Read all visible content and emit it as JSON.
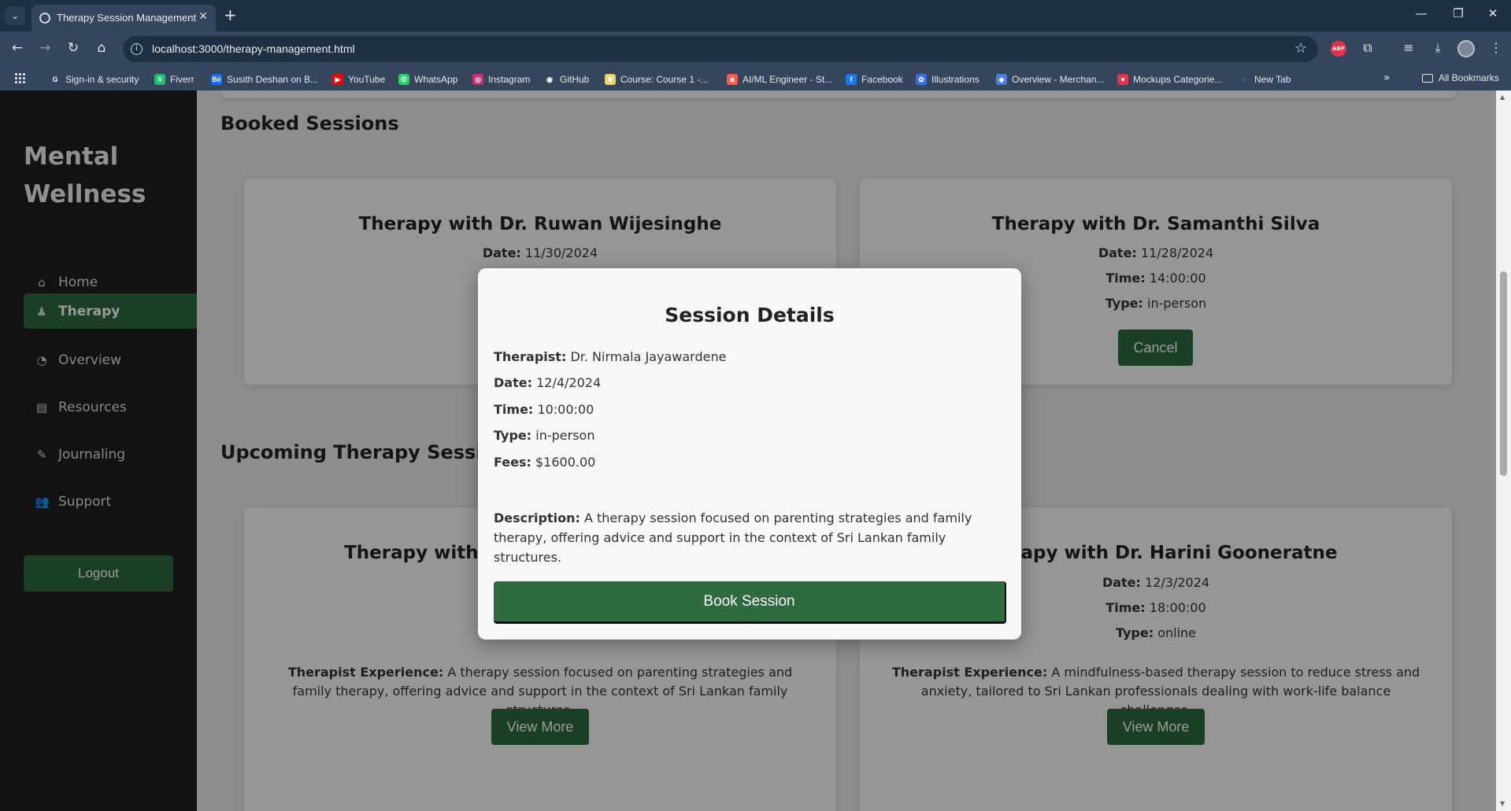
{
  "browser": {
    "tab_title": "Therapy Session Management",
    "url": "localhost:3000/therapy-management.html",
    "bookmarks": [
      {
        "label": "Sign-in & security",
        "icon": "google-icon",
        "color": "#ffffff"
      },
      {
        "label": "Fiverr",
        "icon": "fiverr-icon",
        "color": "#1dbf73"
      },
      {
        "label": "Susith Deshan on B...",
        "icon": "behance-icon",
        "color": "#1769ff"
      },
      {
        "label": "YouTube",
        "icon": "youtube-icon",
        "color": "#ff0000"
      },
      {
        "label": "WhatsApp",
        "icon": "whatsapp-icon",
        "color": "#25d366"
      },
      {
        "label": "Instagram",
        "icon": "instagram-icon",
        "color": "#d62976"
      },
      {
        "label": "GitHub",
        "icon": "github-icon",
        "color": "#ffffff"
      },
      {
        "label": "Course: Course 1 -...",
        "icon": "course-icon",
        "color": "#f5d060"
      },
      {
        "label": "AI/ML Engineer - St...",
        "icon": "aiml-icon",
        "color": "#ff5a4f"
      },
      {
        "label": "Facebook",
        "icon": "facebook-icon",
        "color": "#1877f2"
      },
      {
        "label": "Illustrations",
        "icon": "illustrations-icon",
        "color": "#3a6df0"
      },
      {
        "label": "Overview - Merchan...",
        "icon": "merch-icon",
        "color": "#4a7fe0"
      },
      {
        "label": "Mockups Categorie...",
        "icon": "mockups-icon",
        "color": "#e2374a"
      },
      {
        "label": "New Tab",
        "icon": "globe-icon",
        "color": "#cfd7e1"
      }
    ],
    "all_bookmarks": "All Bookmarks"
  },
  "sidebar": {
    "brand": "Mental Wellness",
    "items": [
      {
        "label": "Home",
        "icon": "home-icon",
        "glyph": "⌂"
      },
      {
        "label": "Therapy",
        "icon": "person-icon",
        "glyph": "♟"
      },
      {
        "label": "Overview",
        "icon": "pie-chart-icon",
        "glyph": "◔"
      },
      {
        "label": "Resources",
        "icon": "book-icon",
        "glyph": "▤"
      },
      {
        "label": "Journaling",
        "icon": "pencil-icon",
        "glyph": "✎"
      },
      {
        "label": "Support",
        "icon": "users-icon",
        "glyph": "👥"
      }
    ],
    "logout": "Logout"
  },
  "booked": {
    "title": "Booked Sessions",
    "cards": [
      {
        "title": "Therapy with Dr. Ruwan Wijesinghe",
        "date_label": "Date:",
        "date": "11/30/2024"
      },
      {
        "title": "Therapy with Dr. Samanthi Silva",
        "date_label": "Date:",
        "date": "11/28/2024",
        "time_label": "Time:",
        "time": "14:00:00",
        "type_label": "Type:",
        "type": "in-person",
        "button": "Cancel"
      }
    ]
  },
  "upcoming": {
    "title": "Upcoming Therapy Sessions",
    "cards": [
      {
        "title": "Therapy with Dr. Nirmala Jayawardene",
        "experience_label": "Therapist Experience:",
        "experience": "A therapy session focused on parenting strategies and family therapy, offering advice and support in the context of Sri Lankan family structures.",
        "button": "View More"
      },
      {
        "title": "Therapy with Dr. Harini Gooneratne",
        "date_label": "Date:",
        "date": "12/3/2024",
        "time_label": "Time:",
        "time": "18:00:00",
        "type_label": "Type:",
        "type": "online",
        "experience_label": "Therapist Experience:",
        "experience": "A mindfulness-based therapy session to reduce stress and anxiety, tailored to Sri Lankan professionals dealing with work-life balance challenges.",
        "button": "View More"
      }
    ]
  },
  "modal": {
    "title": "Session Details",
    "therapist_label": "Therapist:",
    "therapist": "Dr. Nirmala Jayawardene",
    "date_label": "Date:",
    "date": "12/4/2024",
    "time_label": "Time:",
    "time": "10:00:00",
    "type_label": "Type:",
    "type": "in-person",
    "fees_label": "Fees:",
    "fees": "$1600.00",
    "description_label": "Description:",
    "description": "A therapy session focused on parenting strategies and family therapy, offering advice and support in the context of Sri Lankan family structures.",
    "button": "Book Session"
  },
  "colors": {
    "accent_green": "#2d6a3e",
    "sidebar_bg": "#1e1e1e",
    "chrome_bg": "#35455c"
  }
}
